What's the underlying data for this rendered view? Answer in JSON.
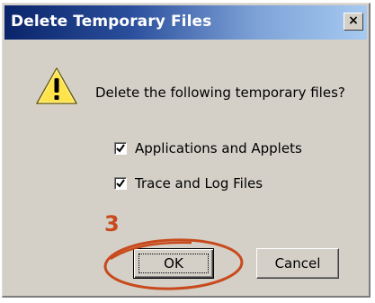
{
  "window": {
    "title": "Delete Temporary Files",
    "close_glyph": "×"
  },
  "icons": {
    "warning": "warning-icon",
    "close": "close-icon",
    "check": "checkmark-icon"
  },
  "message": "Delete the following temporary files?",
  "options": [
    {
      "label": "Applications and Applets",
      "checked": true
    },
    {
      "label": "Trace and Log Files",
      "checked": true
    }
  ],
  "annotation": {
    "step_number": "3",
    "color": "#c84a1c"
  },
  "buttons": {
    "ok": "OK",
    "cancel": "Cancel"
  },
  "colors": {
    "title_bar_start": "#0a246a",
    "title_bar_end": "#a6caf0",
    "dialog_face": "#d4d0c8",
    "warning_yellow": "#ffe34a"
  }
}
